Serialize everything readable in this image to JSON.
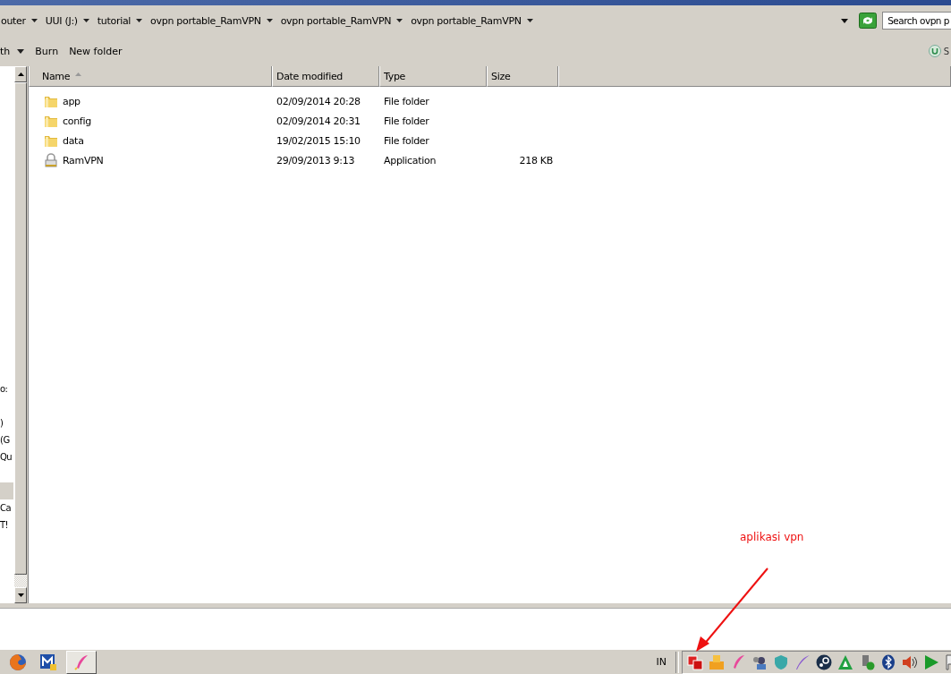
{
  "address_bar": {
    "crumbs": [
      "outer",
      "UUI (J:)",
      "tutorial",
      "ovpn portable_RamVPN",
      "ovpn portable_RamVPN",
      "ovpn portable_RamVPN"
    ]
  },
  "search": {
    "placeholder": "Search ovpn p"
  },
  "toolbar": {
    "items": [
      "th",
      "Burn",
      "New folder"
    ],
    "help_label": "S"
  },
  "nav_pane": {
    "items": [
      {
        "label": "o:",
        "selected": false
      },
      {
        "label": ")",
        "selected": false
      },
      {
        "label": "(G",
        "selected": false
      },
      {
        "label": "Qu",
        "selected": false
      },
      {
        "selected": true
      },
      {
        "label": "Ca",
        "selected": false
      },
      {
        "label": "T!",
        "selected": false
      }
    ]
  },
  "table": {
    "columns": [
      {
        "label": "Name",
        "sorted": true
      },
      {
        "label": "Date modified",
        "sorted": false
      },
      {
        "label": "Type",
        "sorted": false
      },
      {
        "label": "Size",
        "sorted": false
      }
    ],
    "rows": [
      {
        "kind": "folder",
        "name": "app",
        "date": "02/09/2014 20:28",
        "type": "File folder"
      },
      {
        "kind": "folder",
        "name": "config",
        "date": "02/09/2014 20:31",
        "type": "File folder"
      },
      {
        "kind": "folder",
        "name": "data",
        "date": "19/02/2015 15:10",
        "type": "File folder"
      },
      {
        "kind": "application",
        "name": "RamVPN",
        "date": "29/09/2013 9:13",
        "type": "Application",
        "size": "218 KB"
      }
    ]
  },
  "taskbar": {
    "apps": [
      {
        "kind": "browser",
        "selected": false
      },
      {
        "kind": "m",
        "selected": false
      },
      {
        "kind": "feather",
        "selected": true
      }
    ],
    "language": "IN"
  },
  "annotation": {
    "text": "aplikasi vpn"
  }
}
